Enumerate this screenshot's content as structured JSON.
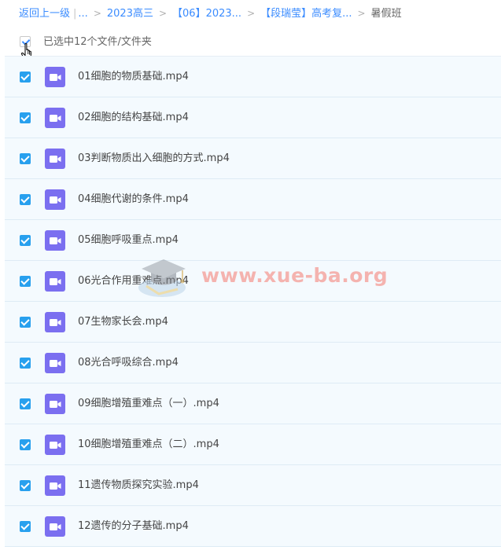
{
  "breadcrumb": {
    "back_label": "返回上一级",
    "pipe": "|",
    "ellipsis_label": "...",
    "separator": ">",
    "items": [
      "2023高三",
      "【06】2023...",
      "【段瑞莹】高考复..."
    ],
    "current": "暑假班"
  },
  "selection": {
    "label": "已选中12个文件/文件夹"
  },
  "files": [
    {
      "name": "01细胞的物质基础.mp4"
    },
    {
      "name": "02细胞的结构基础.mp4"
    },
    {
      "name": "03判断物质出入细胞的方式.mp4"
    },
    {
      "name": "04细胞代谢的条件.mp4"
    },
    {
      "name": "05细胞呼吸重点.mp4"
    },
    {
      "name": "06光合作用重难点.mp4"
    },
    {
      "name": "07生物家长会.mp4"
    },
    {
      "name": "08光合呼吸综合.mp4"
    },
    {
      "name": "09细胞增殖重难点（一）.mp4"
    },
    {
      "name": "10细胞增殖重难点（二）.mp4"
    },
    {
      "name": "11遗传物质探究实验.mp4"
    },
    {
      "name": "12遗传的分子基础.mp4"
    }
  ],
  "watermark": {
    "text": "www.xue-ba.org"
  },
  "colors": {
    "link": "#3b8cff",
    "checkbox": "#28a0ee",
    "video_icon": "#7b6ff0",
    "row_bg": "#f4fafe",
    "row_border": "#deebf5"
  },
  "icons": {
    "file": "video-file-icon",
    "cursor": "hand-pointer-icon",
    "watermark_logo": "graduation-cap-icon"
  }
}
